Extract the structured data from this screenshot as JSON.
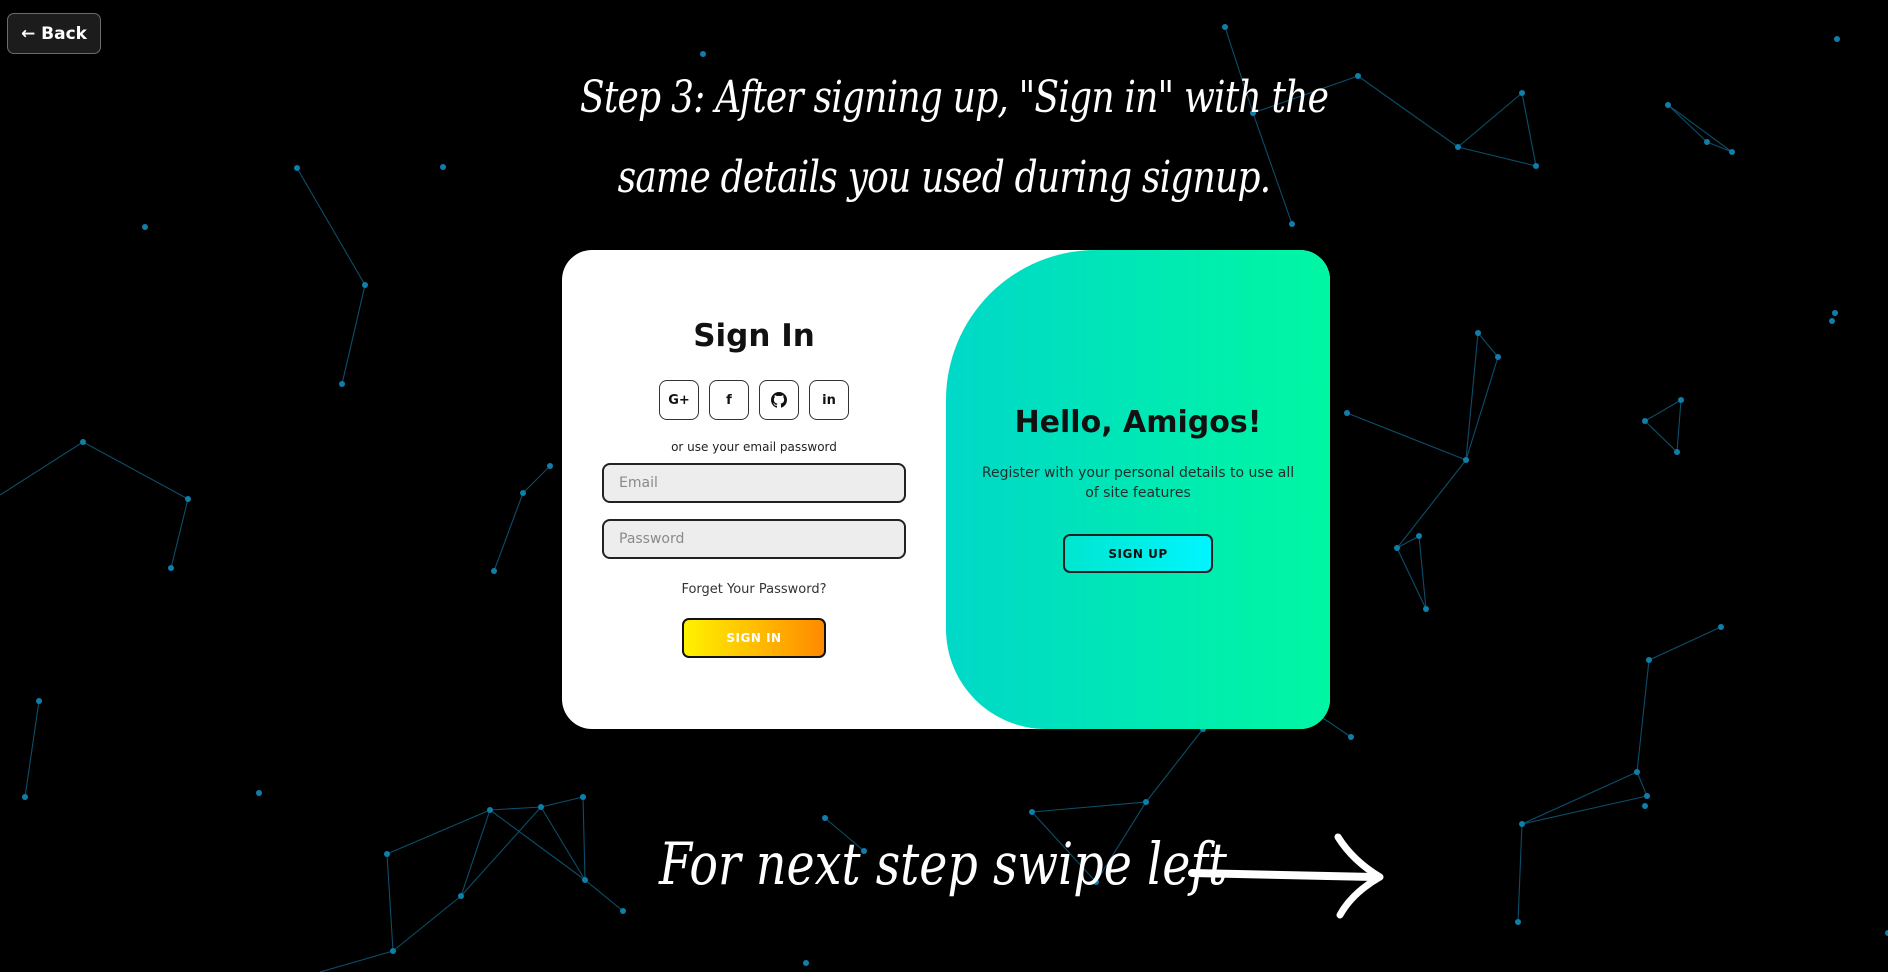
{
  "nav": {
    "back_label": "← Back"
  },
  "headline": {
    "line1": "Step 3: After signing up, \"Sign in\" with the",
    "line2": "same details you used during signup."
  },
  "signin": {
    "title": "Sign In",
    "social_icons": [
      "google-plus-icon",
      "facebook-icon",
      "github-icon",
      "linkedin-icon"
    ],
    "google_label": "G+",
    "facebook_label": "f",
    "linkedin_label": "in",
    "hint": "or use your email password",
    "email_placeholder": "Email",
    "password_placeholder": "Password",
    "forgot": "Forget Your Password?",
    "button": "SIGN IN"
  },
  "welcome": {
    "title": "Hello, Amigos!",
    "text": "Register with your personal details to use all of site features",
    "button": "SIGN UP"
  },
  "footer": {
    "swipe_text": "For next step swipe left"
  },
  "colors": {
    "background": "#000000",
    "network_node": "#0f7eaa",
    "signin_gradient_start": "#fff200",
    "signin_gradient_end": "#ff8a00",
    "panel_gradient_start": "#00d8c8",
    "panel_gradient_end": "#00f7a2"
  }
}
